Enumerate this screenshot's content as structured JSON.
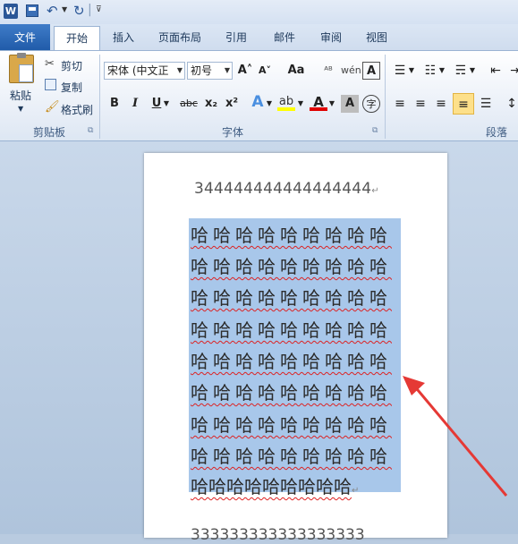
{
  "app": {
    "logo_letter": "W"
  },
  "qat": {
    "separator_glyph": "|"
  },
  "tabs": [
    {
      "label": "文件"
    },
    {
      "label": "开始"
    },
    {
      "label": "插入"
    },
    {
      "label": "页面布局"
    },
    {
      "label": "引用"
    },
    {
      "label": "邮件"
    },
    {
      "label": "审阅"
    },
    {
      "label": "视图"
    }
  ],
  "clipboard": {
    "paste_label": "粘贴",
    "cut_label": "剪切",
    "copy_label": "复制",
    "format_painter_label": "格式刷",
    "group_label": "剪贴板"
  },
  "font": {
    "font_name": "宋体 (中文正",
    "font_size": "初号",
    "grow_glyph": "A˄",
    "shrink_glyph": "A˅",
    "case_glyph": "Aa",
    "bold": "B",
    "italic": "I",
    "underline": "U",
    "strike": "abc",
    "subscript": "x₂",
    "superscript": "x²",
    "group_label": "字体"
  },
  "paragraph": {
    "group_label": "段落"
  },
  "document": {
    "line1": "344444444444444444",
    "ha_line": "哈哈哈哈哈哈哈哈哈",
    "ha_line_last": "哈哈哈哈哈哈哈哈哈",
    "bottom_line": "333333333333333333",
    "paragraph_mark": "↵"
  },
  "colors": {
    "accent": "#2b5797",
    "selection": "#a8c7ea",
    "arrow": "#e53935"
  }
}
